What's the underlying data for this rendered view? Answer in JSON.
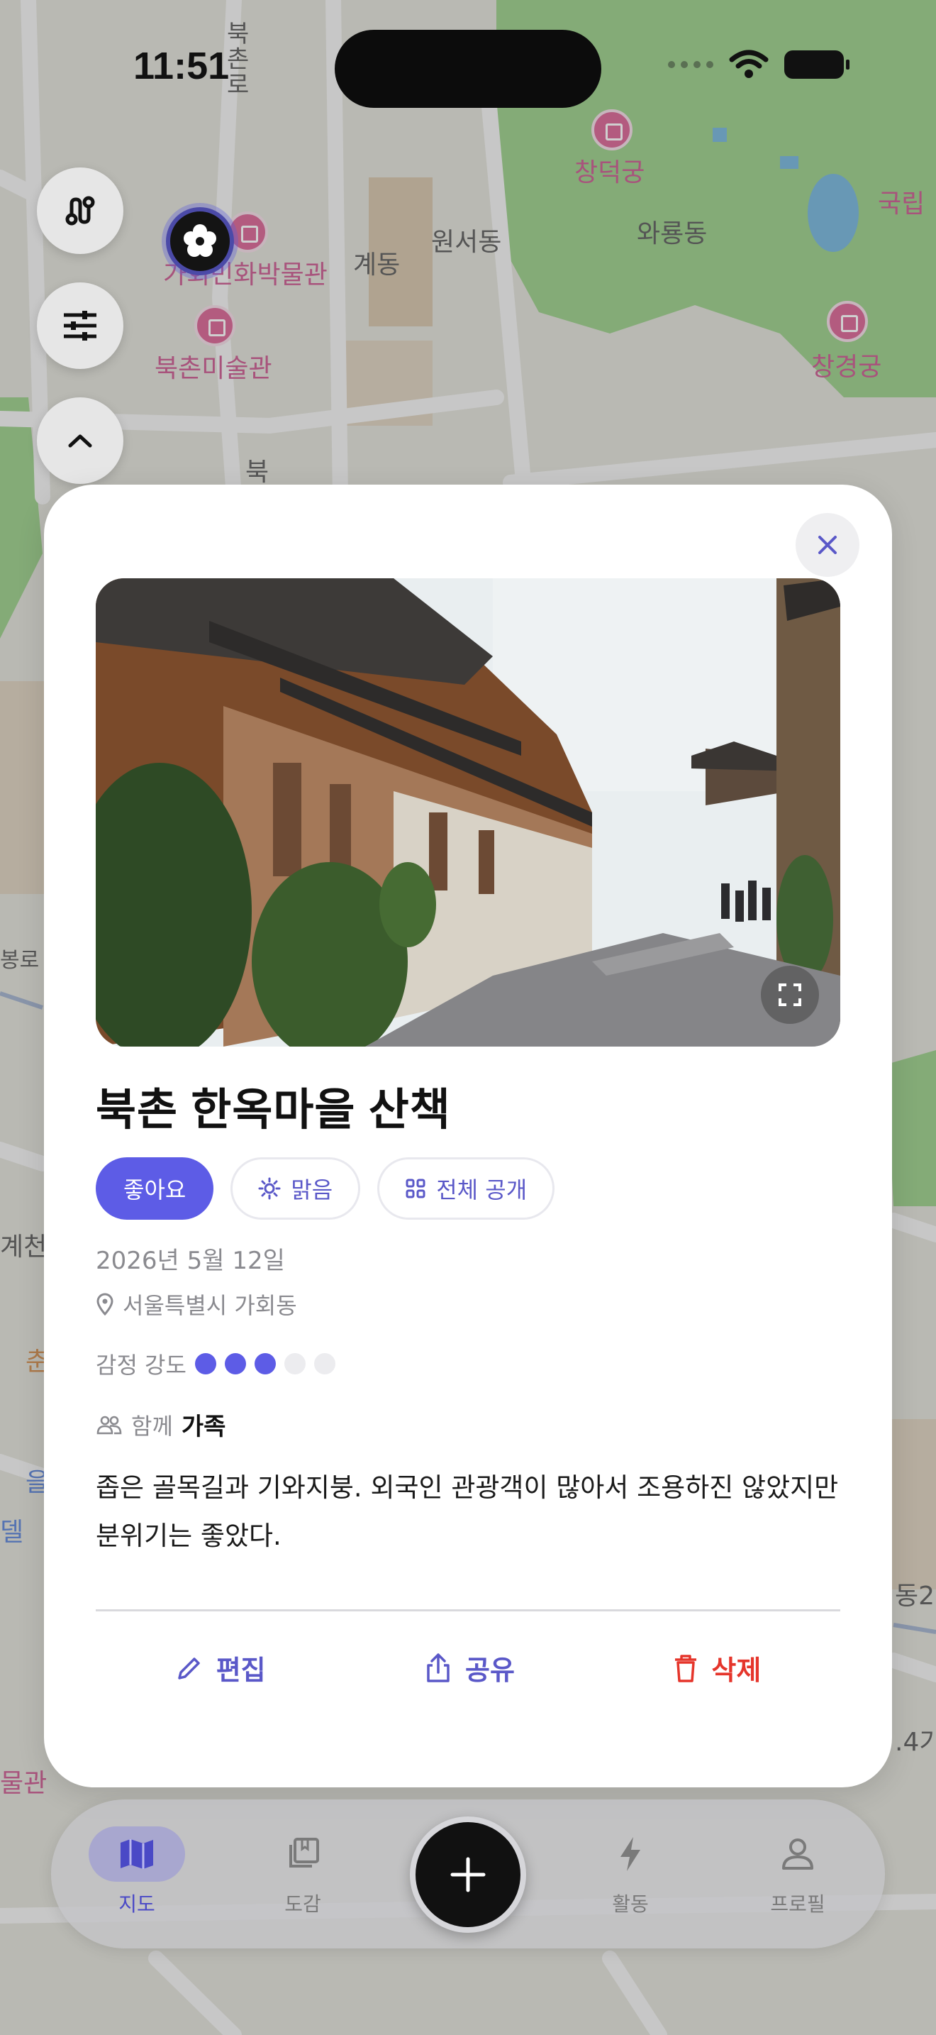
{
  "status_bar": {
    "time": "11:51"
  },
  "map": {
    "labels": {
      "bukchon_ro": "북\n촌\n로",
      "changdeokgung": "창덕궁",
      "gyedong": "계동",
      "wonseodong": "원서동",
      "waryongdong": "와룡동",
      "gukrip": "국립",
      "museum": "가회민화박물관",
      "bukchon_art": "북촌미술관",
      "changgyeonggung": "창경궁",
      "buk": "북",
      "gyesan": "계천",
      "bongro": "봉로",
      "dong2": "동2",
      "n4": ".4가",
      "mulgwan": "물관",
      "chun": "춘",
      "eul": "을",
      "el": "델"
    }
  },
  "map_controls": {
    "route_icon": "route-icon",
    "filter_icon": "sliders-icon",
    "collapse_icon": "chevron-up-icon"
  },
  "card": {
    "close_icon": "close-icon",
    "title": "북촌 한옥마을 산책",
    "chips": {
      "mood": "좋아요",
      "weather": "맑음",
      "visibility": "전체 공개"
    },
    "date": "2026년 5월 12일",
    "location": "서울특별시 가회동",
    "emotion": {
      "label": "감정 강도",
      "level": 3,
      "max": 5
    },
    "with": {
      "label": "함께",
      "value": "가족"
    },
    "memo": "좁은 골목길과 기와지붕. 외국인 관광객이 많아서 조용하진 않았지만 분위기는 좋았다.",
    "actions": {
      "edit": "편집",
      "share": "공유",
      "delete": "삭제"
    }
  },
  "tabbar": {
    "map": "지도",
    "collection": "도감",
    "activity": "활동",
    "profile": "프로필"
  },
  "colors": {
    "accent": "#5d5ce6",
    "danger": "#e5352b",
    "map_green": "#7fbf6a",
    "poi_pink": "#d2457f"
  }
}
